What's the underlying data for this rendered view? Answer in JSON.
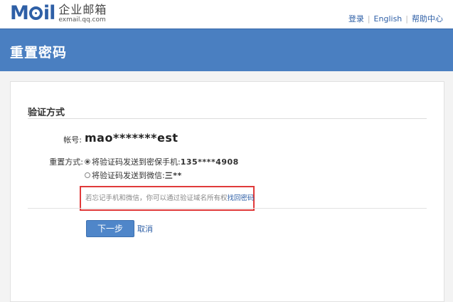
{
  "header": {
    "logo_brand": "Moil",
    "logo_cn": "企业邮箱",
    "logo_domain": "exmail.qq.com",
    "links": [
      "登录",
      "English",
      "帮助中心"
    ]
  },
  "banner": {
    "title": "重置密码"
  },
  "form": {
    "section_title": "验证方式",
    "account_label": "帐号:",
    "account_value": "mao*******est",
    "reset_label": "重置方式:",
    "options": [
      {
        "text": "将验证码发送到密保手机:",
        "value": "135****4908",
        "selected": true
      },
      {
        "text": "将验证码发送到微信:",
        "value": "三**",
        "selected": false
      }
    ],
    "hint_text": "若忘记手机和微信，你可以通过验证域名所有权",
    "hint_link": "找回密码",
    "next_button": "下一步",
    "cancel_link": "取消"
  },
  "colors": {
    "brand_blue": "#2e5fa6",
    "banner_bg": "#4a7fc1",
    "button_bg": "#4f86c9",
    "highlight_box": "#e03a3a"
  }
}
